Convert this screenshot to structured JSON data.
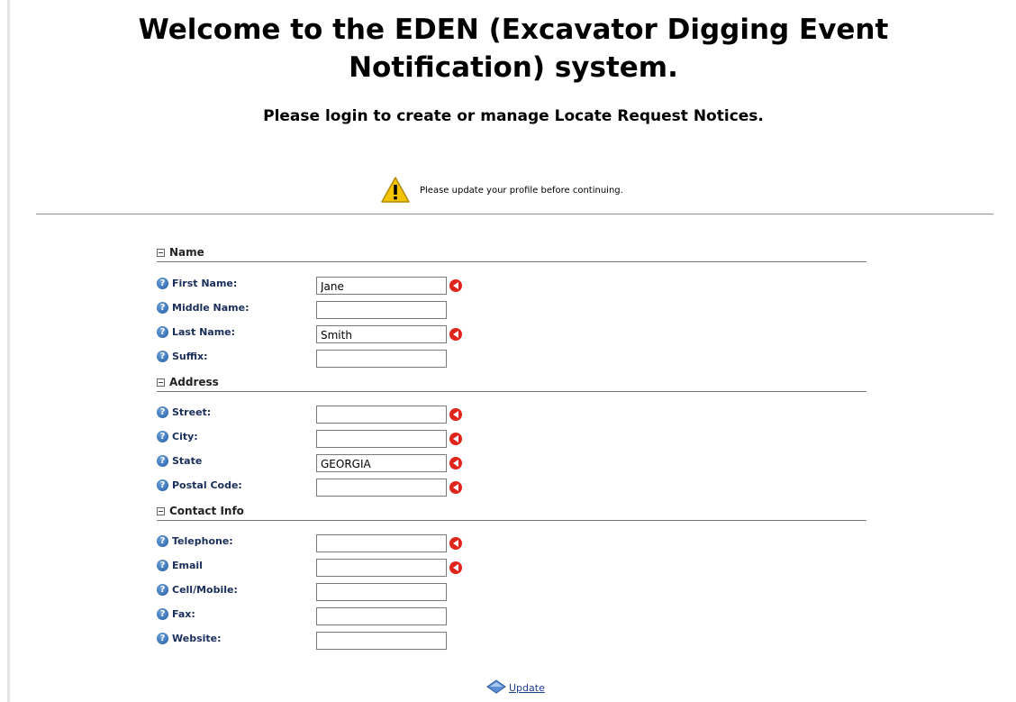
{
  "header": {
    "title": "Welcome to the EDEN (Excavator Digging Event Notification) system.",
    "subtitle": "Please login to create or manage Locate Request Notices."
  },
  "notice": {
    "text": "Please update your profile before continuing.",
    "icon": "warning-icon"
  },
  "sections": {
    "name": {
      "title": "Name",
      "fields": {
        "first_name": {
          "label": "First Name:",
          "value": "Jane",
          "required": true
        },
        "middle_name": {
          "label": "Middle Name:",
          "value": "",
          "required": false
        },
        "last_name": {
          "label": "Last Name:",
          "value": "Smith",
          "required": true
        },
        "suffix": {
          "label": "Suffix:",
          "value": "",
          "required": false
        }
      }
    },
    "address": {
      "title": "Address",
      "fields": {
        "street": {
          "label": "Street:",
          "value": "",
          "required": true
        },
        "city": {
          "label": "City:",
          "value": "",
          "required": true
        },
        "state": {
          "label": "State",
          "value": "GEORGIA",
          "required": true
        },
        "postal_code": {
          "label": "Postal Code:",
          "value": "",
          "required": true
        }
      }
    },
    "contact": {
      "title": "Contact Info",
      "fields": {
        "telephone": {
          "label": "Telephone:",
          "value": "",
          "required": true
        },
        "email": {
          "label": "Email",
          "value": "",
          "required": true
        },
        "cell": {
          "label": "Cell/Mobile:",
          "value": "",
          "required": false
        },
        "fax": {
          "label": "Fax:",
          "value": "",
          "required": false
        },
        "website": {
          "label": "Website:",
          "value": "",
          "required": false
        }
      }
    }
  },
  "actions": {
    "update_label": "Update"
  },
  "colors": {
    "required_marker": "#e0261c",
    "help_icon": "#1f5aa6",
    "label_text": "#1a2e5a",
    "link": "#1f3f8c"
  }
}
